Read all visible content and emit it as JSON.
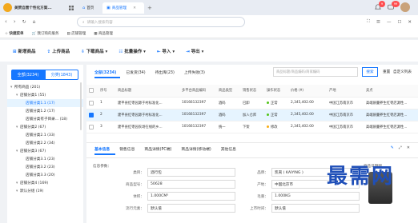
{
  "browser": {
    "shop_name": "美赞自营个性化方案...",
    "tabs": [
      {
        "label": "首页"
      },
      {
        "label": "商品管理"
      }
    ],
    "badge_count": "9",
    "badge_count2": "99",
    "search_placeholder": "请输入搜索内容"
  },
  "bookmarks": [
    {
      "label": "快捷菜单"
    },
    {
      "label": "我订购的服务"
    },
    {
      "label": "店铺管理"
    },
    {
      "label": "商品管理"
    }
  ],
  "toolbar": [
    {
      "label": "新增商品"
    },
    {
      "label": "上传商品"
    },
    {
      "label": "下载商品"
    },
    {
      "label": "批量操作"
    },
    {
      "label": "导入"
    },
    {
      "label": "导出"
    }
  ],
  "sidebar": {
    "seg_all": "全部(3234)",
    "seg_category": "分类(1843)",
    "tree": [
      {
        "label": "所有商品 (201)",
        "indent": 0,
        "selected": false
      },
      {
        "label": "店铺分类1 (55)",
        "indent": 1,
        "selected": false
      },
      {
        "label": "店铺分类1.1 (17)",
        "indent": 2,
        "selected": true
      },
      {
        "label": "店铺分类1.2 (17)",
        "indent": 2,
        "selected": false
      },
      {
        "label": "店铺分类有子目录... (18)",
        "indent": 2,
        "selected": false
      },
      {
        "label": "店铺分类2 (67)",
        "indent": 1,
        "selected": false
      },
      {
        "label": "店铺分类2.1 (33)",
        "indent": 2,
        "selected": false
      },
      {
        "label": "店铺分类2.2 (34)",
        "indent": 2,
        "selected": false
      },
      {
        "label": "店铺分类3 (67)",
        "indent": 1,
        "selected": false
      },
      {
        "label": "店铺分类3.1 (23)",
        "indent": 2,
        "selected": false
      },
      {
        "label": "店铺分类3.2 (23)",
        "indent": 2,
        "selected": false
      },
      {
        "label": "店铺分类3.3 (20)",
        "indent": 2,
        "selected": false
      },
      {
        "label": "店铺分类4 (169)",
        "indent": 1,
        "selected": false
      },
      {
        "label": "默认分组 (19)",
        "indent": 1,
        "selected": false
      }
    ]
  },
  "filters": {
    "tabs": [
      {
        "label": "全部(3234)"
      },
      {
        "label": "已发货(34)"
      },
      {
        "label": "待出库(23)"
      },
      {
        "label": "上传失败(3)"
      }
    ],
    "search_placeholder": "商品标题/商品编码/商家编码",
    "search_button": "搜索",
    "reset_link": "重置",
    "custom_link": "自定义列表"
  },
  "table": {
    "headers": [
      "序号",
      "商品标题",
      "多平台商品编码",
      "商品类型",
      "销售状态",
      "操作状态",
      "价格 (¥)",
      "产地",
      "卖点"
    ],
    "rows": [
      {
        "no": "1",
        "title": "建平县红枣园源于村标准化...",
        "code": "10166132397",
        "type": "酒码",
        "sale": "已卸",
        "status": "正常",
        "status_color": "#52c41a",
        "price": "2,345,402.00",
        "origin": "中国江苏南京市",
        "selling": "高端质量养生红枣店源性...",
        "checked": false
      },
      {
        "no": "2",
        "title": "建平县红枣园源于村标准化...",
        "code": "10166132397",
        "type": "酒码",
        "sale": "加入仓库",
        "status": "正常",
        "status_color": "#52c41a",
        "price": "2,345,402.00",
        "origin": "中国江苏南京市",
        "selling": "高端质量养生红枣店源性...",
        "checked": true
      },
      {
        "no": "3",
        "title": "建平县红枣园农场在线的乡...",
        "code": "10166132397",
        "type": "统一",
        "sale": "下架",
        "status": "修改",
        "status_color": "#faad14",
        "price": "2,345,402.00",
        "origin": "中国江苏南京市",
        "selling": "高端质量养生红枣店源性...",
        "checked": false
      }
    ]
  },
  "detail": {
    "tabs": [
      {
        "label": "基本信息"
      },
      {
        "label": "销售信息"
      },
      {
        "label": "商品详情(PC端)"
      },
      {
        "label": "商品详情(移动端)"
      },
      {
        "label": "其他信息"
      }
    ],
    "section_title": "信息参数：",
    "left_fields": [
      {
        "label": "类目：",
        "value": "酒行包"
      },
      {
        "label": "商品型号：",
        "value": "50628"
      },
      {
        "label": "体积：",
        "value": "1.000CM³"
      },
      {
        "label": "流行元素：",
        "value": "默认值"
      }
    ],
    "right_fields": [
      {
        "label": "品牌：",
        "value": "凯夷 ( KAIYING )"
      },
      {
        "label": "产地：",
        "value": "中国北京市"
      },
      {
        "label": "毛重：",
        "value": "1.000KG"
      },
      {
        "label": "上市时间：",
        "value": "默认值"
      }
    ],
    "image_section": "商品日期图",
    "image_actions": "编辑"
  },
  "watermark": "最需网"
}
